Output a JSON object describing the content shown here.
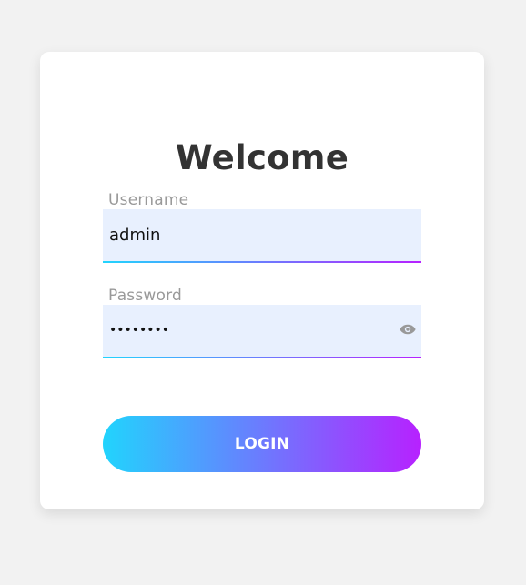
{
  "colors": {
    "background": "#f2f2f2",
    "card": "#ffffff",
    "field_background": "#e8f0fe",
    "gradient_start": "#21d4fd",
    "gradient_end": "#b721ff",
    "label": "#999999",
    "title": "#333333"
  },
  "login_form": {
    "title": "Welcome",
    "username": {
      "label": "Username",
      "value": "admin"
    },
    "password": {
      "label": "Password",
      "value": "••••••••",
      "toggle_icon": "eye-icon"
    },
    "submit_label": "LOGIN"
  }
}
